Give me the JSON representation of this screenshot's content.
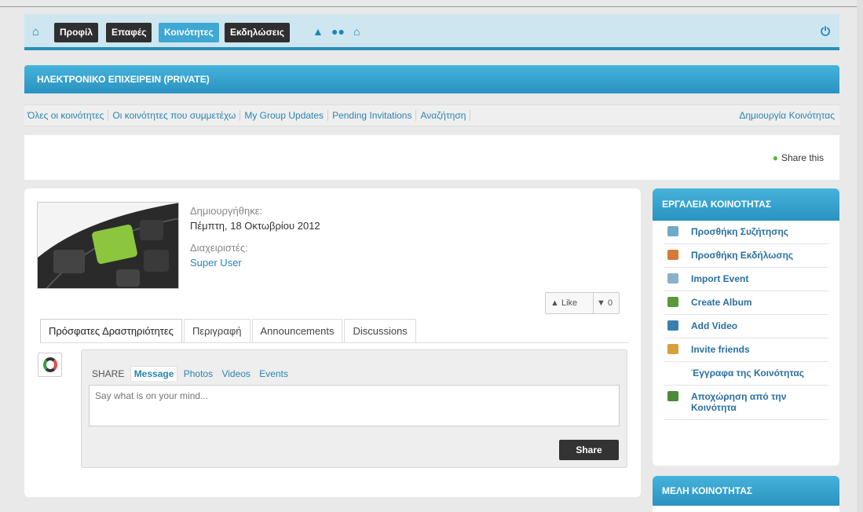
{
  "nav": {
    "home_icon": "home-icon",
    "items": [
      {
        "label": "Προφίλ",
        "active": false
      },
      {
        "label": "Επαφές",
        "active": false
      },
      {
        "label": "Κοινότητες",
        "active": true
      },
      {
        "label": "Εκδηλώσεις",
        "active": false
      }
    ],
    "icons": [
      "bell-icon",
      "users-icon",
      "inbox-icon"
    ],
    "power_icon": "power-icon"
  },
  "group": {
    "title": "ΗΛΕΚΤΡΟΝΙΚΟ ΕΠΙΧΕΙΡΕΙΝ (PRIVATE)"
  },
  "subnav": {
    "links": [
      "Όλες οι κοινότητες",
      "Οι κοινότητες που συμμετέχω",
      "My Group Updates",
      "Pending Invitations",
      "Αναζήτηση"
    ],
    "create": "Δημιουργία Κοινότητας"
  },
  "share_this": "Share this",
  "info": {
    "created_label": "Δημιουργήθηκε:",
    "created_value": "Πέμπτη, 18 Οκτωβρίου 2012",
    "admins_label": "Διαχειριστές:",
    "admin_user": "Super User"
  },
  "likes": {
    "like_label": "Like",
    "dislike_count": "0"
  },
  "tabs": [
    "Πρόσφατες Δραστηριότητες",
    "Περιγραφή",
    "Announcements",
    "Discussions"
  ],
  "composer": {
    "share_label": "SHARE",
    "options": [
      "Message",
      "Photos",
      "Videos",
      "Events"
    ],
    "placeholder": "Say what is on your mind...",
    "share_button": "Share"
  },
  "sidebar": {
    "title": "ΕΡΓΑΛΕΙΑ ΚΟΙΝΟΤΗΤΑΣ",
    "items": [
      {
        "label": "Προσθήκη Συζήτησης",
        "icon": "discussion-icon",
        "color": "#6fa8c8"
      },
      {
        "label": "Προσθήκη Εκδήλωσης",
        "icon": "calendar-icon",
        "color": "#d67a3a"
      },
      {
        "label": "Import Event",
        "icon": "import-event-icon",
        "color": "#8ab0cc"
      },
      {
        "label": "Create Album",
        "icon": "album-icon",
        "color": "#5a9a3a"
      },
      {
        "label": "Add Video",
        "icon": "video-icon",
        "color": "#3a7fb0"
      },
      {
        "label": "Invite friends",
        "icon": "invite-icon",
        "color": "#d8a03a"
      },
      {
        "label": "Έγγραφα της Κοινότητας",
        "icon": "",
        "color": ""
      },
      {
        "label": "Αποχώρηση από την Κοινότητα",
        "icon": "leave-icon",
        "color": "#4a8a3a"
      }
    ],
    "members_title": "ΜΕΛΗ ΚΟΙΝΟΤΗΤΑΣ"
  }
}
